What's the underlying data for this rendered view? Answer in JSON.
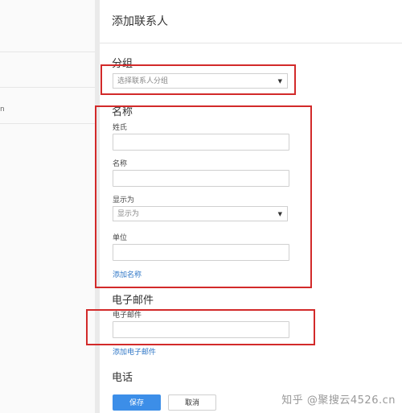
{
  "left_list": {
    "items": [
      "",
      "",
      "n",
      ""
    ]
  },
  "panel": {
    "title": "添加联系人"
  },
  "group": {
    "section_title": "分组",
    "select_placeholder": "选择联系人分组",
    "caret": "▼"
  },
  "name_section": {
    "title": "名称",
    "surname_label": "姓氏",
    "name_label": "名称",
    "display_label": "显示为",
    "display_placeholder": "显示为",
    "display_caret": "▼",
    "company_label": "单位",
    "add_name_link": "添加名称"
  },
  "email_section": {
    "title": "电子邮件",
    "email_label": "电子邮件",
    "add_email_link": "添加电子邮件"
  },
  "phone_section": {
    "title": "电话"
  },
  "buttons": {
    "save": "保存",
    "cancel": "取消"
  },
  "watermark": "知乎 @聚搜云4526.cn",
  "colors": {
    "highlight": "#d22a2a",
    "primary": "#3c8ee8",
    "link": "#2e76c6"
  }
}
